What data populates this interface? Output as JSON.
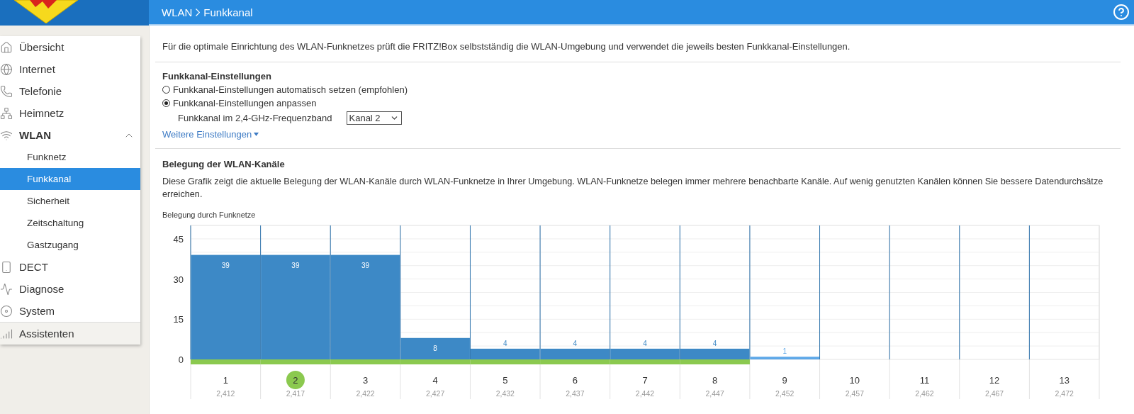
{
  "header": {
    "breadcrumb": [
      "WLAN",
      "Funkkanal"
    ]
  },
  "sidebar": {
    "items": [
      {
        "label": "Übersicht",
        "selected": false
      },
      {
        "label": "Internet",
        "selected": false
      },
      {
        "label": "Telefonie",
        "selected": false
      },
      {
        "label": "Heimnetz",
        "selected": false
      },
      {
        "label": "WLAN",
        "selected": false,
        "expanded": true,
        "children": [
          {
            "label": "Funknetz",
            "selected": false
          },
          {
            "label": "Funkkanal",
            "selected": true
          },
          {
            "label": "Sicherheit",
            "selected": false
          },
          {
            "label": "Zeitschaltung",
            "selected": false
          },
          {
            "label": "Gastzugang",
            "selected": false
          }
        ]
      },
      {
        "label": "DECT",
        "selected": false
      },
      {
        "label": "Diagnose",
        "selected": false
      },
      {
        "label": "System",
        "selected": false
      }
    ],
    "footer_item": {
      "label": "Assistenten"
    }
  },
  "intro": "Für die optimale Einrichtung des WLAN-Funknetzes prüft die FRITZ!Box selbstständig die WLAN-Umgebung und verwendet die jeweils besten Funkkanal-Einstellungen.",
  "settings": {
    "heading": "Funkkanal-Einstellungen",
    "options": [
      {
        "label": "Funkkanal-Einstellungen automatisch setzen (empfohlen)",
        "selected": false
      },
      {
        "label": "Funkkanal-Einstellungen anpassen",
        "selected": true
      }
    ],
    "band_label": "Funkkanal im 2,4-GHz-Frequenzband",
    "band_value": "Kanal 2",
    "more_link": "Weitere Einstellungen"
  },
  "usage": {
    "heading": "Belegung der WLAN-Kanäle",
    "description": "Diese Grafik zeigt die aktuelle Belegung der WLAN-Kanäle durch WLAN-Funknetze in Ihrer Umgebung. WLAN-Funknetze belegen immer mehrere benachbarte Kanäle. Auf wenig genutzten Kanälen können Sie bessere Datendurchsätze erreichen.",
    "chart_label": "Belegung durch Funknetze",
    "channels": [
      {
        "frequency": "2,412",
        "selected": false,
        "own": true
      },
      {
        "frequency": "2,417",
        "selected": true,
        "own": true
      },
      {
        "frequency": "2,422",
        "selected": false,
        "own": true
      },
      {
        "frequency": "2,427",
        "selected": false,
        "own": true
      },
      {
        "frequency": "2,432",
        "selected": false,
        "own": true
      },
      {
        "frequency": "2,437",
        "selected": false,
        "own": true
      },
      {
        "frequency": "2,442",
        "selected": false,
        "own": true
      },
      {
        "frequency": "2,447",
        "selected": false,
        "own": true
      },
      {
        "frequency": "2,452",
        "selected": false,
        "own": false
      },
      {
        "frequency": "2,457",
        "selected": false,
        "own": false
      },
      {
        "frequency": "2,462",
        "selected": false,
        "own": false
      },
      {
        "frequency": "2,467",
        "selected": false,
        "own": false
      },
      {
        "frequency": "2,472",
        "selected": false,
        "own": false
      }
    ],
    "chart_data": {
      "type": "bar",
      "grid": true,
      "categories": [
        "1",
        "2",
        "3",
        "4",
        "5",
        "6",
        "7",
        "8",
        "9",
        "10",
        "11",
        "12",
        "13"
      ],
      "ylim": [
        0,
        50
      ],
      "yticks": [
        0,
        15,
        30,
        45
      ],
      "data_labels": true,
      "series": [
        {
          "color": "#3d89c6",
          "values": [
            39,
            39,
            39,
            8,
            4,
            4,
            4,
            4,
            null,
            null,
            null,
            null,
            null
          ]
        },
        {
          "color": "#5ea8e8",
          "values": [
            null,
            null,
            null,
            null,
            null,
            null,
            null,
            null,
            1,
            null,
            null,
            null,
            null
          ]
        }
      ]
    }
  }
}
